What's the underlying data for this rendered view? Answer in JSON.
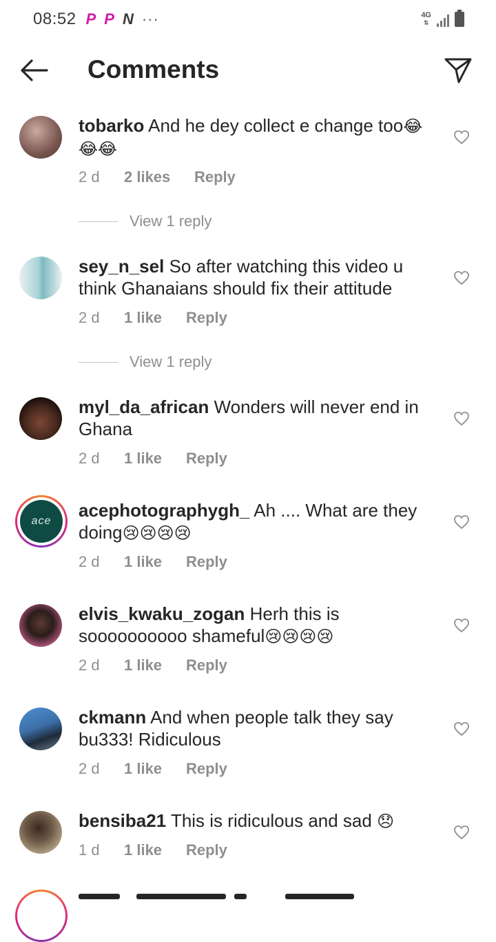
{
  "status_bar": {
    "time": "08:52",
    "apps": [
      "P",
      "P",
      "N"
    ],
    "more": "···",
    "network": "4G"
  },
  "header": {
    "title": "Comments",
    "back_icon": "arrow-left-icon",
    "send_icon": "paper-plane-icon"
  },
  "comments": [
    {
      "username": "tobarko",
      "text": "And he dey collect e change too",
      "emoji": "😂😂😂",
      "age": "2 d",
      "likes": "2 likes",
      "reply": "Reply",
      "view_replies": "View 1 reply",
      "avatar_color": "#8a6b64"
    },
    {
      "username": "sey_n_sel",
      "text": "So after watching this video u think Ghanaians should fix their attitude",
      "emoji": "",
      "age": "2 d",
      "likes": "1 like",
      "reply": "Reply",
      "view_replies": "View 1 reply",
      "avatar_color": "#a9d3d9"
    },
    {
      "username": "myl_da_african",
      "text": "Wonders will never end in Ghana",
      "emoji": "",
      "age": "2 d",
      "likes": "1 like",
      "reply": "Reply",
      "avatar_color": "#3b2118"
    },
    {
      "username": "acephotographygh_",
      "text": "Ah .... What are they doing",
      "emoji": "😢😢😢😢",
      "age": "2 d",
      "likes": "1 like",
      "reply": "Reply",
      "avatar_logo": "ace",
      "avatar_color": "#0f4b44"
    },
    {
      "username": "elvis_kwaku_zogan",
      "text": "Herh this is soooooooooo shameful",
      "emoji": "😢😢😢😢",
      "age": "2 d",
      "likes": "1 like",
      "reply": "Reply",
      "avatar_color": "#2a1d1a"
    },
    {
      "username": "ckmann",
      "text": "And when people talk they say bu333! Ridiculous",
      "emoji": "",
      "age": "2 d",
      "likes": "1 like",
      "reply": "Reply",
      "avatar_color": "#3c6fa8"
    },
    {
      "username": "bensiba21",
      "text": "This is ridiculous and sad",
      "emoji": "😞",
      "age": "1 d",
      "likes": "1 like",
      "reply": "Reply",
      "avatar_color": "#9a8a73"
    }
  ],
  "colors": {
    "text": "#262626",
    "muted": "#8e8e8e",
    "accent_p": "#d21aa8"
  }
}
